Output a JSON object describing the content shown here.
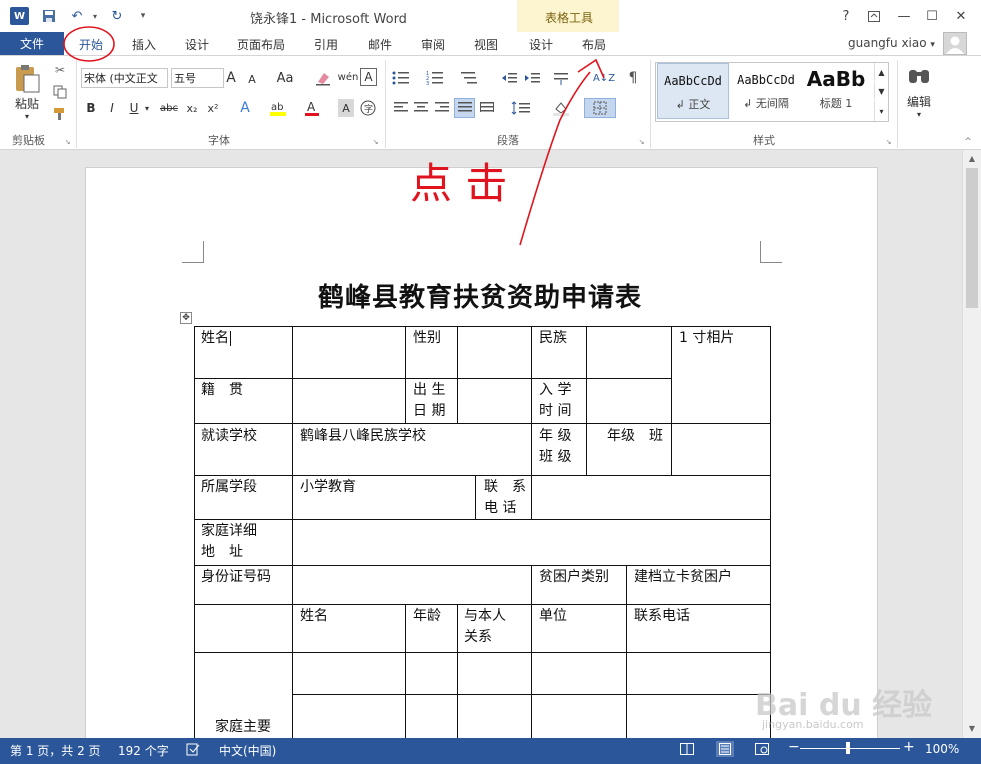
{
  "titlebar": {
    "app_icon": "W",
    "title": "饶永锋1 - Microsoft Word",
    "context_group": "表格工具",
    "help": "?",
    "restore_icon": "ribbon-display-icon",
    "minimize": "—",
    "maximize": "☐",
    "close": "✕"
  },
  "tabs": {
    "file": "文件",
    "home": "开始",
    "insert": "插入",
    "design": "设计",
    "layout_page": "页面布局",
    "references": "引用",
    "mailings": "邮件",
    "review": "审阅",
    "view": "视图",
    "table_design": "设计",
    "table_layout": "布局"
  },
  "user": {
    "name": "guangfu xiao",
    "dropdown": "▾"
  },
  "ribbon": {
    "clipboard": {
      "paste": "粘贴",
      "group": "剪贴板"
    },
    "font": {
      "font_name": "宋体 (中文正文",
      "font_size": "五号",
      "grow": "A",
      "shrink": "A",
      "change_case": "Aa",
      "phonetic": "wén",
      "border_char": "A",
      "bold": "B",
      "italic": "I",
      "underline": "U",
      "strike": "abc",
      "sub": "x₂",
      "sup": "x²",
      "group": "字体"
    },
    "paragraph": {
      "group": "段落"
    },
    "styles": {
      "items": [
        {
          "sample": "AaBbCcDd",
          "name": "↲ 正文"
        },
        {
          "sample": "AaBbCcDd",
          "name": "↲ 无间隔"
        },
        {
          "sample": "AaBb",
          "name": "标题 1"
        }
      ],
      "group": "样式"
    },
    "editing": {
      "label": "编辑"
    }
  },
  "annotation": {
    "text": "点  击"
  },
  "document": {
    "heading": "鹤峰县教育扶贫资助申请表",
    "table": {
      "name_label": "姓名",
      "gender_label": "性别",
      "ethnicity_label": "民族",
      "photo_label": "1 寸相片",
      "native_1": "籍　贯",
      "birth_1": "出 生",
      "birth_2": "日 期",
      "enroll_1": "入 学",
      "enroll_2": "时 间",
      "school_label": "就读学校",
      "school_value": "鹤峰县八峰民族学校",
      "grade_1": "年 级",
      "grade_2": "班 级",
      "grade_value": "年级　班",
      "stage_label": "所属学段",
      "stage_value": "小学教育",
      "phone_1": "联　系",
      "phone_2": "电 话",
      "addr_1": "家庭详细",
      "addr_2": "地　址",
      "id_label": "身份证号码",
      "poor_type_label": "贫困户类别",
      "poor_type_value": "建档立卡贫困户",
      "m_name": "姓名",
      "m_age": "年龄",
      "m_rel_1": "与本人",
      "m_rel_2": "关系",
      "m_unit": "单位",
      "m_phone": "联系电话",
      "family_label": "家庭主要"
    }
  },
  "status": {
    "pages": "第 1 页，共 2 页",
    "words": "192 个字",
    "language": "中文(中国)",
    "zoom_minus": "−",
    "zoom_plus": "+",
    "zoom": "100%",
    "zoom_level": 1.0
  },
  "watermark": {
    "main": "Bai du 经验",
    "sub": "jingyan.baidu.com"
  },
  "colors": {
    "accent": "#2b579a",
    "context_bg": "#fdf5cf",
    "annotation": "#e0141e"
  }
}
